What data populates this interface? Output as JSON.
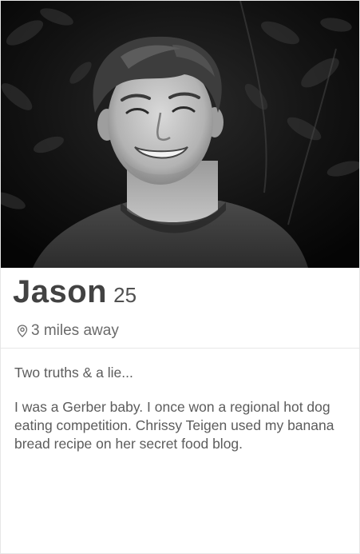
{
  "profile": {
    "name": "Jason",
    "age": "25",
    "distance": "3 miles away",
    "bio_intro": "Two truths & a lie...",
    "bio_body": "I was a Gerber baby. I once won a regional hot dog eating competition. Chrissy Teigen used my banana bread recipe on her secret food blog."
  },
  "photo": {
    "description_icon": "profile-photo",
    "tone": "black-and-white"
  },
  "icons": {
    "location": "location-pin-icon"
  },
  "colors": {
    "name_text": "#424242",
    "secondary_text": "#6a6a6a",
    "divider": "#e8e8e8"
  }
}
